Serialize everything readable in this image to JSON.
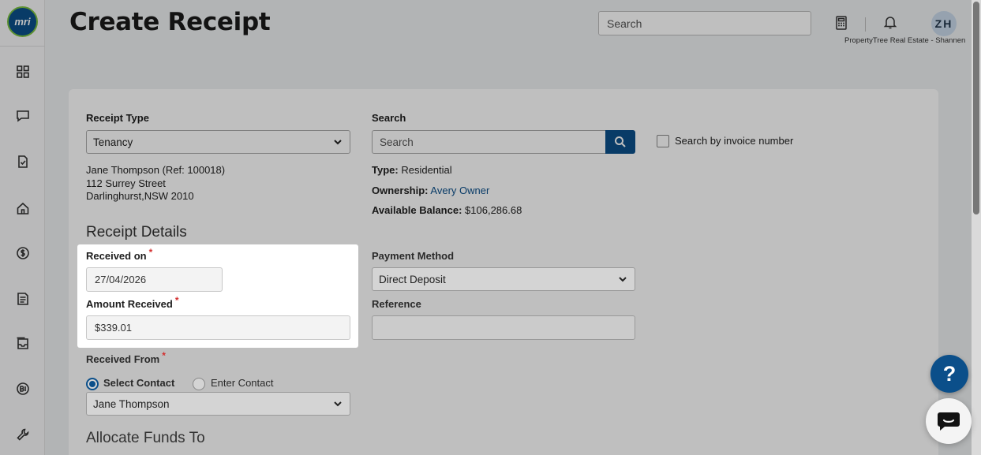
{
  "header": {
    "title": "Create Receipt",
    "search_placeholder": "Search",
    "avatar_initials": "ZH",
    "company": "PropertyTree Real Estate - Shannen"
  },
  "logo": {
    "text": "mri"
  },
  "sidebar": {
    "icons": [
      "dashboard-icon",
      "chat-icon",
      "document-check-icon",
      "home-icon",
      "dollar-icon",
      "notes-icon",
      "inbox-icon",
      "bi-icon",
      "wrench-icon"
    ]
  },
  "form": {
    "receipt_type_label": "Receipt Type",
    "receipt_type_value": "Tenancy",
    "tenant_name": "Jane Thompson (Ref: 100018)",
    "tenant_street": "112 Surrey Street",
    "tenant_suburb": "Darlinghurst,NSW 2010",
    "search_label": "Search",
    "search_placeholder": "Search",
    "invoice_checkbox_label": "Search by invoice number",
    "type_label": "Type:",
    "type_value": "Residential",
    "ownership_label": "Ownership:",
    "ownership_value": "Avery Owner",
    "balance_label": "Available Balance:",
    "balance_value": "$106,286.68",
    "receipt_details_title": "Receipt Details",
    "received_on_label": "Received on",
    "received_on_value": "27/04/2026",
    "amount_label": "Amount Received",
    "amount_value": "$339.01",
    "payment_method_label": "Payment Method",
    "payment_method_value": "Direct Deposit",
    "reference_label": "Reference",
    "reference_value": "",
    "received_from_label": "Received From",
    "select_contact_label": "Select Contact",
    "enter_contact_label": "Enter Contact",
    "contact_value": "Jane Thompson",
    "allocate_title": "Allocate Funds To",
    "required_mark": "*"
  },
  "widgets": {
    "help_label": "?"
  },
  "colors": {
    "brand": "#0b4f8a",
    "logo_ring": "#7cc242",
    "required": "#d32f2f"
  }
}
